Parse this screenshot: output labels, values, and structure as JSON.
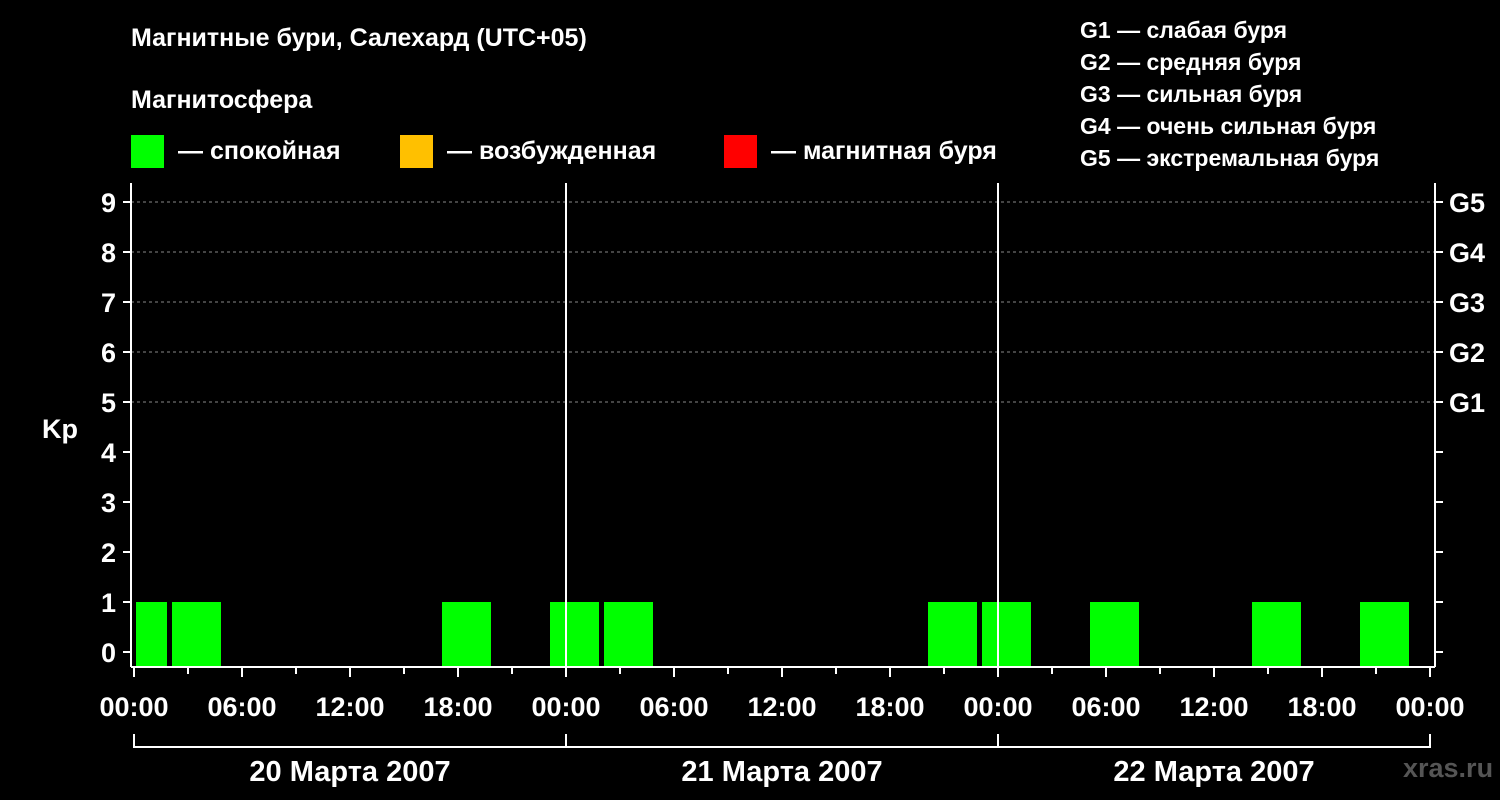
{
  "title": "Магнитные бури, Салехард (UTC+05)",
  "legend": {
    "title": "Магнитосфера",
    "items": [
      {
        "label": "— спокойная",
        "color": "#00ff00"
      },
      {
        "label": "— возбужденная",
        "color": "#ffc000"
      },
      {
        "label": "— магнитная буря",
        "color": "#ff0000"
      }
    ]
  },
  "g_legend": [
    "G1 — слабая буря",
    "G2 — средняя буря",
    "G3 — сильная буря",
    "G4 — очень сильная буря",
    "G5 — экстремальная буря"
  ],
  "watermark": "xras.ru",
  "chart_data": {
    "type": "bar",
    "ylabel": "Kp",
    "ylim": [
      0,
      9
    ],
    "yticks": [
      "0",
      "1",
      "2",
      "3",
      "4",
      "5",
      "6",
      "7",
      "8",
      "9"
    ],
    "right_axis_labels": [
      {
        "kp": 5,
        "label": "G1"
      },
      {
        "kp": 6,
        "label": "G2"
      },
      {
        "kp": 7,
        "label": "G3"
      },
      {
        "kp": 8,
        "label": "G4"
      },
      {
        "kp": 9,
        "label": "G5"
      }
    ],
    "grid": "dashed horizontal at Kp 5–9",
    "xlim_hours": [
      0,
      72
    ],
    "xtick_labels": [
      "00:00",
      "06:00",
      "12:00",
      "18:00",
      "00:00",
      "06:00",
      "12:00",
      "18:00",
      "00:00",
      "06:00",
      "12:00",
      "18:00",
      "00:00"
    ],
    "days": [
      "20 Марта 2007",
      "21 Марта 2007",
      "22 Марта 2007"
    ],
    "bars": [
      {
        "start_hour": 0,
        "end_hour": 2,
        "kp": 1,
        "level": "спокойная"
      },
      {
        "start_hour": 2,
        "end_hour": 5,
        "kp": 1,
        "level": "спокойная"
      },
      {
        "start_hour": 17,
        "end_hour": 20,
        "kp": 1,
        "level": "спокойная"
      },
      {
        "start_hour": 23,
        "end_hour": 26,
        "kp": 1,
        "level": "спокойная"
      },
      {
        "start_hour": 26,
        "end_hour": 29,
        "kp": 1,
        "level": "спокойная"
      },
      {
        "start_hour": 44,
        "end_hour": 47,
        "kp": 1,
        "level": "спокойная"
      },
      {
        "start_hour": 47,
        "end_hour": 50,
        "kp": 1,
        "level": "спокойная"
      },
      {
        "start_hour": 53,
        "end_hour": 56,
        "kp": 1,
        "level": "спокойная"
      },
      {
        "start_hour": 62,
        "end_hour": 65,
        "kp": 1,
        "level": "спокойная"
      },
      {
        "start_hour": 68,
        "end_hour": 71,
        "kp": 1,
        "level": "спокойная"
      }
    ]
  }
}
